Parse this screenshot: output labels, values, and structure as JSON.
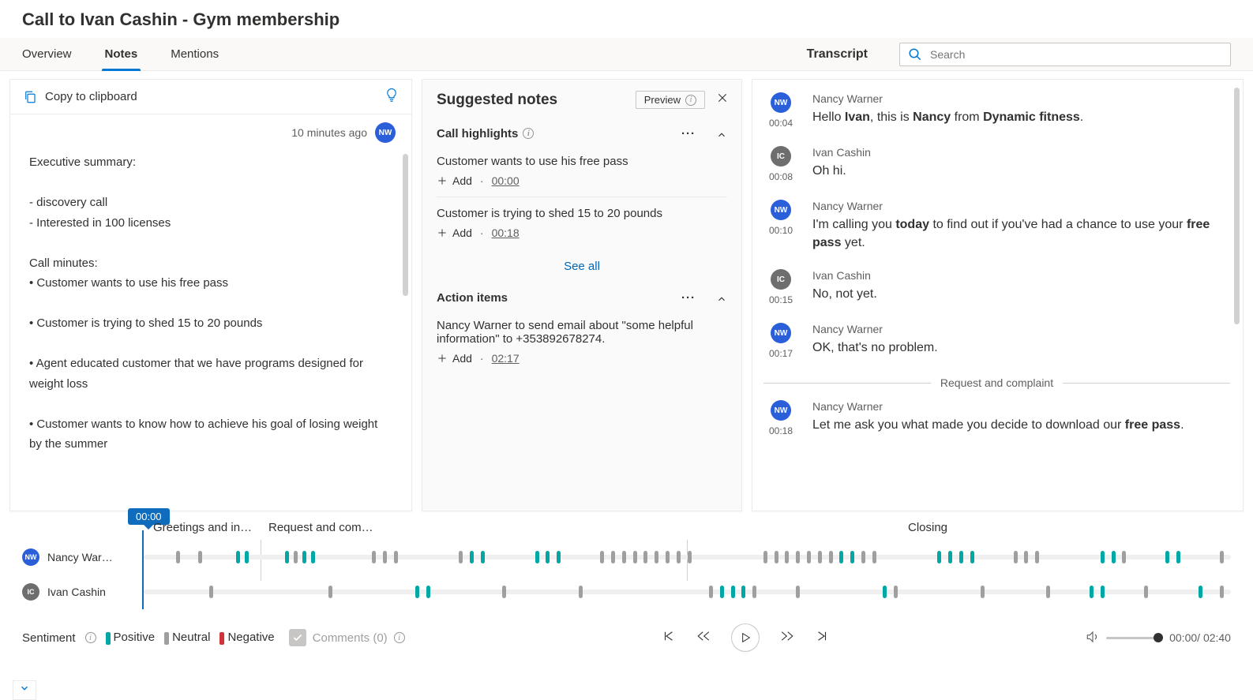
{
  "page_title": "Call to Ivan Cashin - Gym membership",
  "tabs": {
    "overview": "Overview",
    "notes": "Notes",
    "mentions": "Mentions"
  },
  "transcript_label": "Transcript",
  "search_placeholder": "Search",
  "notes": {
    "copy": "Copy to clipboard",
    "time_ago": "10 minutes ago",
    "author_initials": "NW",
    "body": "Executive summary:\n\n- discovery call\n- Interested in 100 licenses\n\nCall minutes:\n• Customer wants to use his free pass\n\n• Customer is trying to shed 15 to 20 pounds\n\n• Agent educated customer that we have programs designed for weight loss\n\n• Customer wants to know how to achieve his goal of losing weight by the summer"
  },
  "suggested": {
    "title": "Suggested notes",
    "preview": "Preview",
    "highlights_title": "Call highlights",
    "items": [
      {
        "text": "Customer wants to use his free pass",
        "ts": "00:00"
      },
      {
        "text": "Customer is trying to shed 15 to 20 pounds",
        "ts": "00:18"
      }
    ],
    "add_label": "Add",
    "see_all": "See all",
    "actions_title": "Action items",
    "action_text": "Nancy Warner to send email about \"some helpful information\" to +353892678274.",
    "action_ts": "02:17"
  },
  "transcript": {
    "divider": "Request and complaint",
    "msgs": [
      {
        "init": "NW",
        "cls": "nw",
        "name": "Nancy Warner",
        "time": "00:04",
        "html": "Hello <b>Ivan</b>, this is <b>Nancy</b> from <b>Dynamic fitness</b>."
      },
      {
        "init": "IC",
        "cls": "ic",
        "name": "Ivan Cashin",
        "time": "00:08",
        "html": "Oh hi."
      },
      {
        "init": "NW",
        "cls": "nw",
        "name": "Nancy Warner",
        "time": "00:10",
        "html": "I'm calling you <b>today</b> to find out if you've had a chance to use your <b>free pass</b> yet."
      },
      {
        "init": "IC",
        "cls": "ic",
        "name": "Ivan Cashin",
        "time": "00:15",
        "html": "No, not yet."
      },
      {
        "init": "NW",
        "cls": "nw",
        "name": "Nancy Warner",
        "time": "00:17",
        "html": "OK, that's no problem."
      },
      {
        "init": "NW",
        "cls": "nw",
        "name": "Nancy Warner",
        "time": "00:18",
        "html": "Let me ask you what made you decide to download our <b>free pass</b>."
      }
    ]
  },
  "timeline": {
    "badge": "00:00",
    "seg_greet": "Greetings and in…",
    "seg_req": "Request and com…",
    "seg_close": "Closing",
    "speaker1": {
      "name": "Nancy War…",
      "init": "NW"
    },
    "speaker2": {
      "name": "Ivan Cashin",
      "init": "IC"
    }
  },
  "controls": {
    "sentiment": "Sentiment",
    "positive": "Positive",
    "neutral": "Neutral",
    "negative": "Negative",
    "comments": "Comments (0)",
    "cur_time": "00:00",
    "total_time": "02:40"
  }
}
